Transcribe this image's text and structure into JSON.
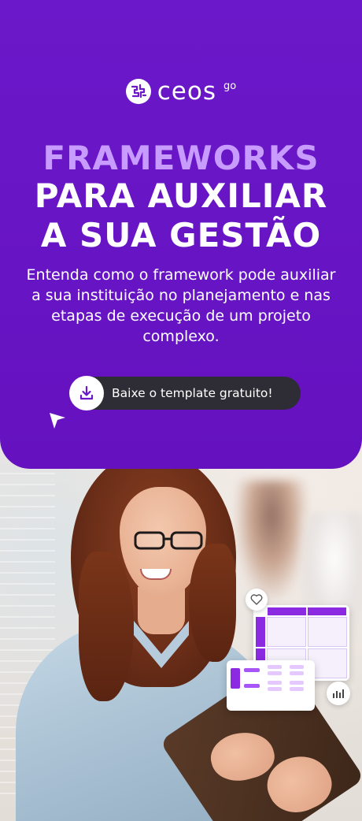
{
  "brand": {
    "logo_text": "ceos",
    "logo_sup": "go"
  },
  "hero": {
    "title_line1": "FRAMEWORKS",
    "title_line2": "PARA AUXILIAR",
    "title_line3": "A SUA GESTÃO",
    "subtitle": "Entenda como o framework pode auxiliar a sua instituição no planejamento e nas etapas de execução de um projeto complexo.",
    "cta_label": "Baixe o template gratuito!",
    "cta_icon": "download-icon"
  },
  "colors": {
    "hero_purple": "#6a18c9",
    "title_accent": "#c89cff",
    "cta_bg": "#2e2d35",
    "white": "#ffffff"
  },
  "floating_ui": {
    "heart_icon": "heart-icon",
    "chart_icon": "bar-chart-icon"
  }
}
